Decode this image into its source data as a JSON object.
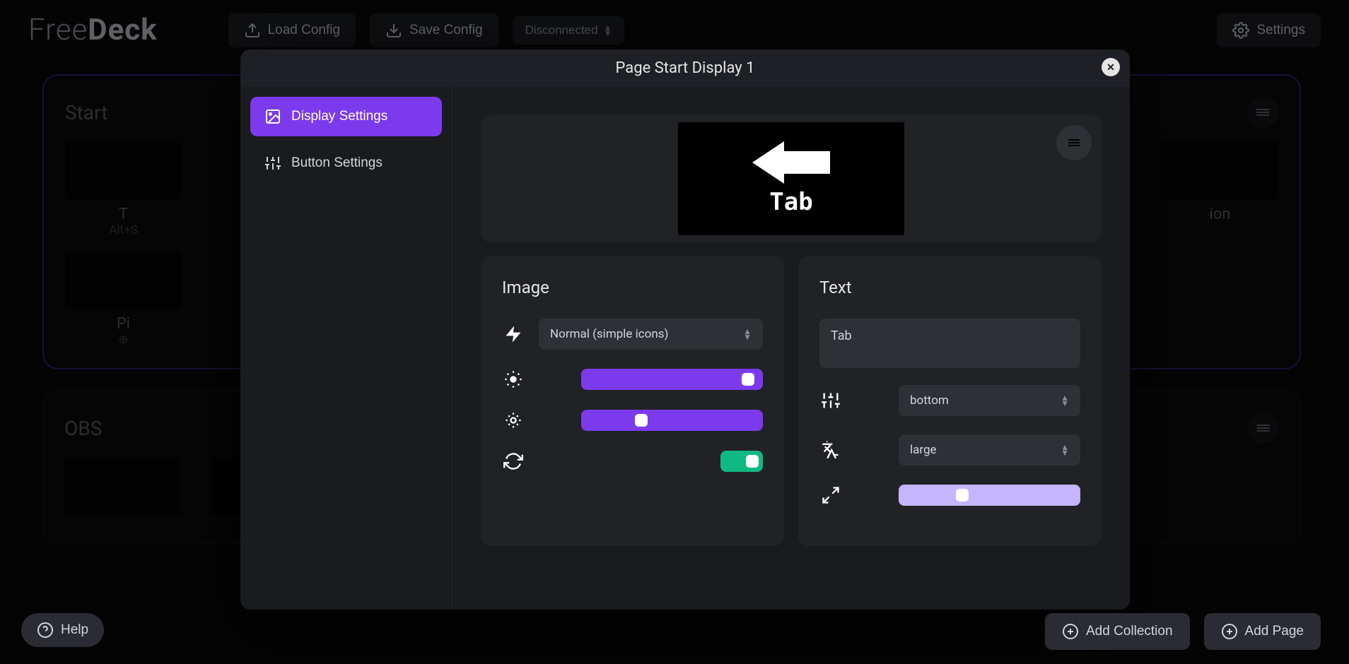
{
  "app": {
    "logo_light": "Free",
    "logo_bold": "Deck"
  },
  "topbar": {
    "load": "Load Config",
    "save": "Save Config",
    "status": "Disconnected",
    "settings": "Settings"
  },
  "help": "Help",
  "bottom": {
    "add_collection": "Add Collection",
    "add_page": "Add Page"
  },
  "bg_pages": {
    "start": {
      "title": "Start",
      "cell0_label": "T",
      "cell0_sub": "Alt+S",
      "cell1_label": "Pi",
      "cell_last_label": "ion"
    },
    "obs": {
      "title": "OBS"
    }
  },
  "modal": {
    "title": "Page Start Display 1",
    "tab_display": "Display Settings",
    "tab_button": "Button Settings",
    "preview_text": "Tab",
    "image": {
      "title": "Image",
      "mode": "Normal (simple icons)",
      "brightness_pct": 92,
      "contrast_pct": 33,
      "invert_on": true
    },
    "text": {
      "title": "Text",
      "value": "Tab",
      "position": "bottom",
      "size": "large",
      "scale_pct": 35
    }
  }
}
